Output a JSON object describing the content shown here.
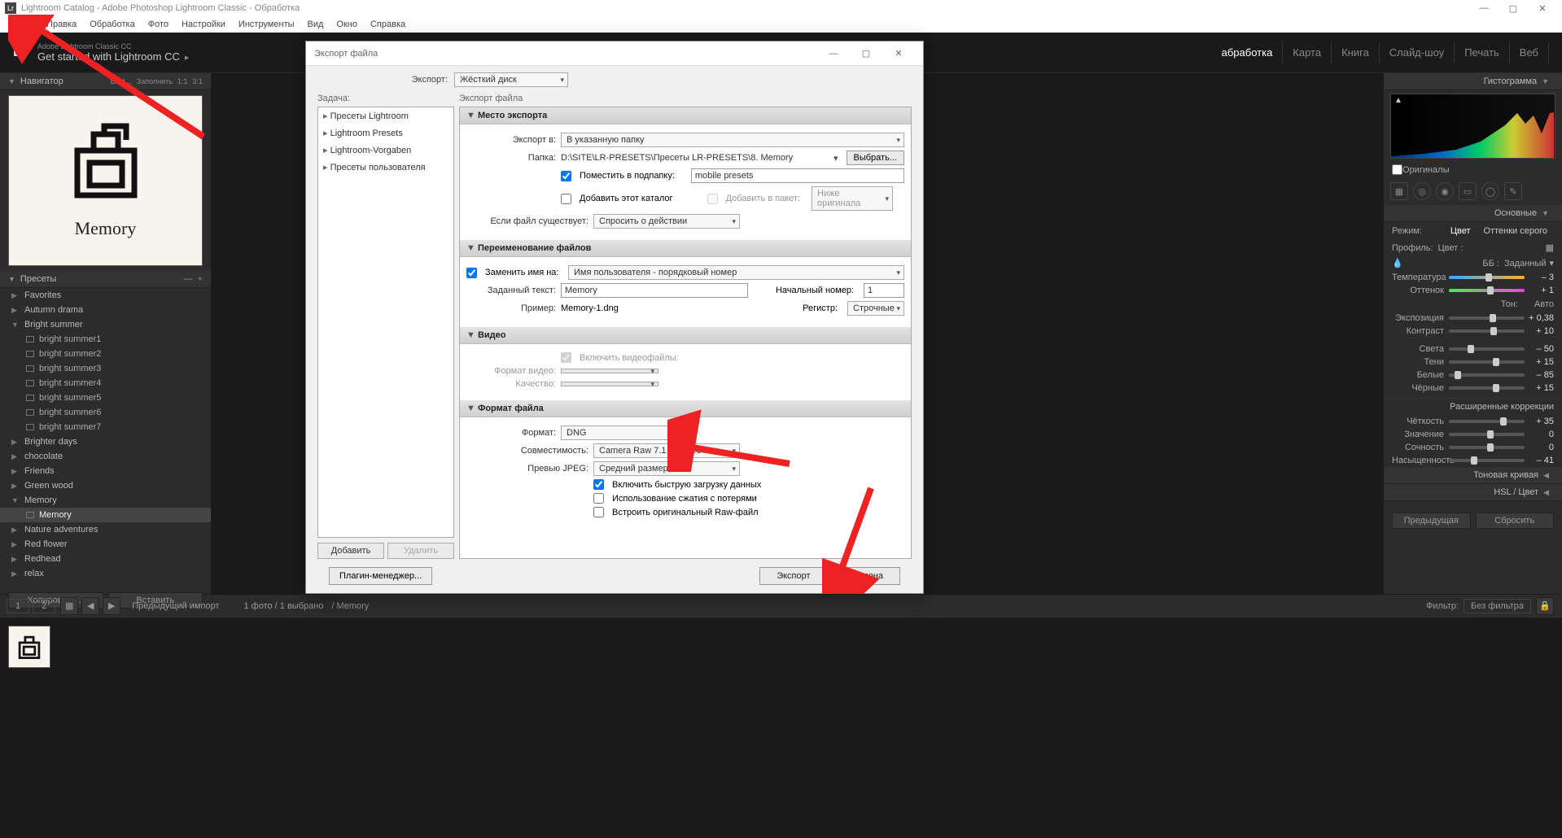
{
  "titlebar": {
    "title": "Lightroom Catalog - Adobe Photoshop Lightroom Classic - Обработка"
  },
  "menubar": [
    "Файл",
    "Правка",
    "Обработка",
    "Фото",
    "Настройки",
    "Инструменты",
    "Вид",
    "Окно",
    "Справка"
  ],
  "header": {
    "lr": "Lr",
    "sub1": "Adobe Lightroom Classic CC",
    "sub2": "Get started with Lightroom CC",
    "tri": "▸",
    "modules": [
      "абработка",
      "Карта",
      "Книга",
      "Слайд-шоу",
      "Печать",
      "Веб"
    ],
    "active_module": 0
  },
  "navigator": {
    "title": "Навигатор",
    "links": [
      "Впи...",
      "Заполнить",
      "1:1",
      "3:1"
    ],
    "thumb_label": "Memory"
  },
  "presets_panel": {
    "title": "Пресеты",
    "folders": [
      {
        "name": "Favorites",
        "exp": false
      },
      {
        "name": "Autumn drama",
        "exp": false
      },
      {
        "name": "Bright summer",
        "exp": true,
        "items": [
          "bright summer1",
          "bright summer2",
          "bright summer3",
          "bright summer4",
          "bright summer5",
          "bright summer6",
          "bright summer7"
        ]
      },
      {
        "name": "Brighter days",
        "exp": false
      },
      {
        "name": "chocolate",
        "exp": false
      },
      {
        "name": "Friends",
        "exp": false
      },
      {
        "name": "Green wood",
        "exp": false
      },
      {
        "name": "Memory",
        "exp": true,
        "items": [
          "Memory"
        ],
        "selected_item": 0
      },
      {
        "name": "Nature adventures",
        "exp": false
      },
      {
        "name": "Red flower",
        "exp": false
      },
      {
        "name": "Redhead",
        "exp": false
      },
      {
        "name": "relax",
        "exp": false
      }
    ],
    "copy_btn": "Копировать...",
    "paste_btn": "Вставить"
  },
  "btm": {
    "tab1": "1",
    "tab2": "2",
    "prev_import": "Предыдущий импорт",
    "count": "1 фото / 1 выбрано",
    "path": "/ Memory",
    "filter_label": "Фильтр:",
    "filter_value": "Без фильтра"
  },
  "right": {
    "histogram": "Гистограмма",
    "originals": "Оригиналы",
    "basic": "Основные",
    "mode": "Режим:",
    "color": "Цвет",
    "grayscale": "Оттенки серого",
    "profile": "Профиль:",
    "profile_val": "Цвет  :",
    "wb_label": "ББ :",
    "wb_val": "Заданный",
    "temp": "Температура",
    "temp_v": "– 3",
    "tint": "Оттенок",
    "tint_v": "+ 1",
    "tone": "Тон:",
    "auto": "Авто",
    "expo": "Экспозиция",
    "expo_v": "+ 0,38",
    "contrast": "Контраст",
    "contrast_v": "+ 10",
    "highlights": "Света",
    "highlights_v": "– 50",
    "shadows": "Тени",
    "shadows_v": "+ 15",
    "whites": "Белые",
    "whites_v": "– 85",
    "blacks": "Чёрные",
    "blacks_v": "+ 15",
    "ext": "Расширенные коррекции",
    "clarity": "Чёткость",
    "clarity_v": "+ 35",
    "dehaze": "Значение",
    "dehaze_v": "0",
    "vib": "Сочность",
    "vib_v": "0",
    "sat": "Насыщенность",
    "sat_v": "– 41",
    "tone_curve": "Тоновая кривая",
    "hsl": "HSL / Цвет",
    "prev": "Предыдущая",
    "reset": "Сбросить"
  },
  "dialog": {
    "title": "Экспорт файла",
    "export_to_label": "Экспорт:",
    "export_to": "Жёсткий диск",
    "task": "Задача:",
    "right_label": "Экспорт файла",
    "left_items": [
      "Пресеты Lightroom",
      "Lightroom Presets",
      "Lightroom-Vorgaben",
      "Пресеты пользователя"
    ],
    "add": "Добавить",
    "remove": "Удалить",
    "plugin": "Плагин-менеджер...",
    "export_btn": "Экспорт",
    "cancel_btn": "Отмена",
    "s1": {
      "hdr": "Место экспорта",
      "export_in": "Экспорт в:",
      "export_in_v": "В указанную папку",
      "folder": "Папка:",
      "folder_v": "D:\\SITE\\LR-PRESETS\\Пресеты LR-PRESETS\\8. Memory",
      "browse": "Выбрать...",
      "put_sub": "Поместить в подпапку:",
      "put_sub_v": "mobile presets",
      "add_cat": "Добавить этот каталог",
      "add_batch": "Добавить в пакет:",
      "below": "Ниже оригинала",
      "if_exists": "Если файл существует:",
      "if_exists_v": "Спросить о действии"
    },
    "s2": {
      "hdr": "Переименование файлов",
      "rename": "Заменить имя на:",
      "rename_v": "Имя пользователя - порядковый номер",
      "custom": "Заданный текст:",
      "custom_v": "Memory",
      "start": "Начальный номер:",
      "start_v": "1",
      "example": "Пример:",
      "example_v": "Memory-1.dng",
      "reg": "Регистр:",
      "reg_v": "Строчные"
    },
    "s3": {
      "hdr": "Видео",
      "include": "Включить видеофайлы:",
      "format": "Формат видео:",
      "quality": "Качество:"
    },
    "s4": {
      "hdr": "Формат файла",
      "format": "Формат:",
      "format_v": "DNG",
      "compat": "Совместимость:",
      "compat_v": "Camera Raw 7.1 и более",
      "preview": "Превью JPEG:",
      "preview_v": "Средний размер",
      "fast": "Включить быструю загрузку данных",
      "lossy": "Использование сжатия с потерями",
      "embed": "Встроить оригинальный Raw-файл"
    }
  }
}
